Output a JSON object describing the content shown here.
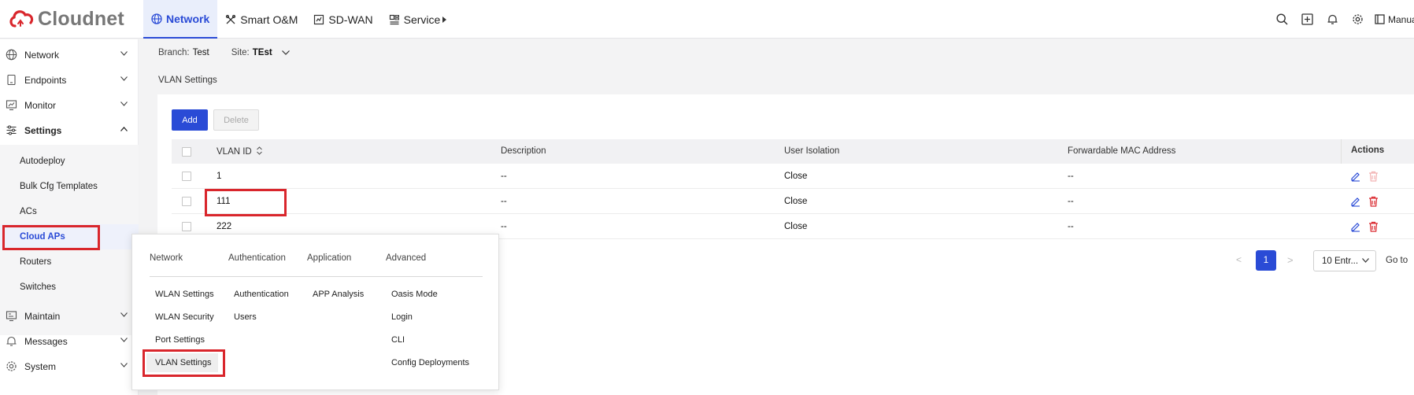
{
  "brand": {
    "name": "Cloudnet",
    "color": "#d9262c"
  },
  "topnav": [
    {
      "label": "Network",
      "icon": "globe-icon",
      "active": true
    },
    {
      "label": "Smart O&M",
      "icon": "tools-icon"
    },
    {
      "label": "SD-WAN",
      "icon": "sdwan-icon"
    },
    {
      "label": "Service",
      "icon": "service-icon"
    }
  ],
  "topright": {
    "manual_label": "Manua"
  },
  "sidebar": {
    "items": [
      {
        "label": "Network",
        "icon": "globe-icon"
      },
      {
        "label": "Endpoints",
        "icon": "endpoint-icon"
      },
      {
        "label": "Monitor",
        "icon": "monitor-icon"
      },
      {
        "label": "Settings",
        "icon": "sliders-icon"
      },
      {
        "label": "Maintain",
        "icon": "maintain-icon"
      },
      {
        "label": "Messages",
        "icon": "bell-icon"
      },
      {
        "label": "System",
        "icon": "gear-icon"
      }
    ],
    "subitems": [
      "Autodeploy",
      "Bulk Cfg Templates",
      "ACs",
      "Cloud APs",
      "Routers",
      "Switches"
    ]
  },
  "branchbar": {
    "branch_key": "Branch:",
    "branch_value": "Test",
    "site_key": "Site:",
    "site_value": "TEst"
  },
  "page": {
    "title": "VLAN Settings",
    "add_label": "Add",
    "delete_label": "Delete"
  },
  "table": {
    "headers": [
      "VLAN ID",
      "Description",
      "User Isolation",
      "Forwardable MAC Address",
      "Actions"
    ],
    "rows": [
      {
        "vlan": "1",
        "desc": "--",
        "isolation": "Close",
        "mac": "--"
      },
      {
        "vlan": "111",
        "desc": "--",
        "isolation": "Close",
        "mac": "--"
      },
      {
        "vlan": "222",
        "desc": "--",
        "isolation": "Close",
        "mac": "--"
      }
    ]
  },
  "pager": {
    "prev": "<",
    "page": "1",
    "next": ">",
    "size": "10 Entr...",
    "goto": "Go to"
  },
  "popup": {
    "columns": [
      {
        "head": "Network",
        "items": [
          "WLAN Settings",
          "WLAN Security",
          "Port Settings",
          "VLAN Settings"
        ]
      },
      {
        "head": "Authentication",
        "items": [
          "Authentication",
          "Users"
        ]
      },
      {
        "head": "Application",
        "items": [
          "APP Analysis"
        ]
      },
      {
        "head": "Advanced",
        "items": [
          "Oasis Mode",
          "Login",
          "CLI",
          "Config Deployments"
        ]
      }
    ]
  },
  "colors": {
    "accent": "#2a4bd6",
    "highlight": "#d9262c"
  }
}
